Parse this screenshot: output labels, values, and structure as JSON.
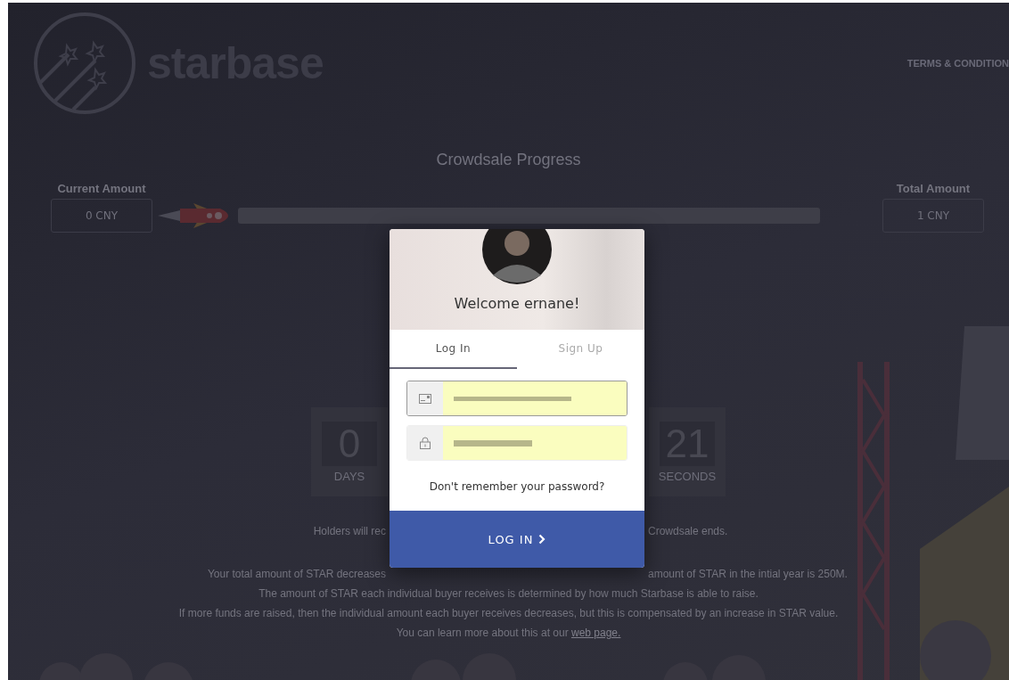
{
  "header": {
    "logo_text": "starbase",
    "nav_link": "TERMS & CONDITION"
  },
  "progress": {
    "title": "Crowdsale Progress",
    "current_label": "Current Amount",
    "current_value": "0 CNY",
    "total_label": "Total Amount",
    "total_value": "1 CNY"
  },
  "countdown": [
    {
      "value": "0",
      "unit": "DAYS"
    },
    {
      "value": "21",
      "unit": "SECONDS"
    }
  ],
  "notes": [
    {
      "left": "Holders will rec",
      "right": "Crowdsale ends."
    },
    {
      "left": "Your total amount of STAR decreases",
      "right": "amount of STAR in the intial year is 250M."
    }
  ],
  "details": [
    "The amount of STAR each individual buyer receives is determined by how much Starbase is able to raise.",
    "If more funds are raised, then the individual amount each buyer receives decreases, but this is compensated by an increase in STAR value."
  ],
  "learn_more": {
    "text": "You can learn more about this at our",
    "link": "web page."
  },
  "modal": {
    "welcome": "Welcome ernane!",
    "tabs": [
      {
        "label": "Log In",
        "selected": true
      },
      {
        "label": "Sign Up",
        "selected": false
      }
    ],
    "fields": [
      {
        "kind": "email",
        "focused": true
      },
      {
        "kind": "password",
        "focused": false
      }
    ],
    "forgot_link": "Don't remember your password?",
    "submit": "LOG IN"
  }
}
